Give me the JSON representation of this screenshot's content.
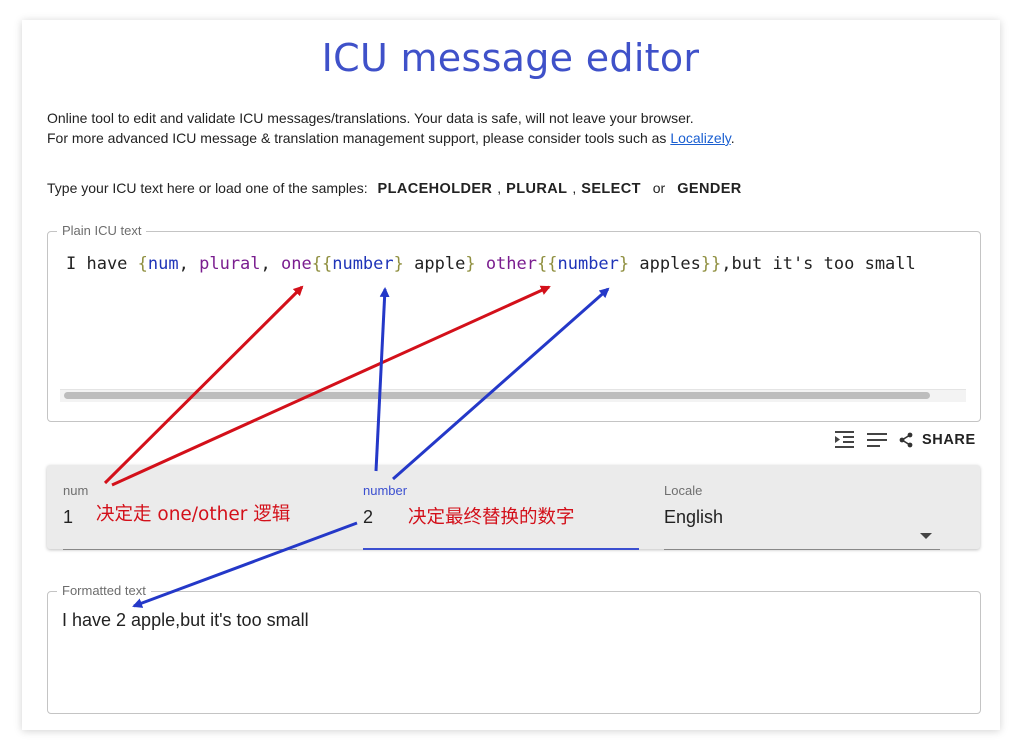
{
  "page": {
    "title": "ICU message editor",
    "description_line1": "Online tool to edit and validate ICU messages/translations. Your data is safe, will not leave your browser.",
    "description_line2_prefix": "For more advanced ICU message & translation management support, please consider tools such as ",
    "description_link": "Localizely",
    "description_line2_suffix": "."
  },
  "samples": {
    "intro": "Type your ICU text here or load one of the samples:",
    "placeholder_label": "PLACEHOLDER",
    "plural_label": "PLURAL",
    "select_label": "SELECT",
    "or_text": "or",
    "gender_label": "GENDER",
    "comma": ","
  },
  "editor": {
    "legend": "Plain ICU text",
    "tokens": {
      "t1": "I have ",
      "t2": "{",
      "t3": "num",
      "t4": ", ",
      "t5": "plural",
      "t6": ", ",
      "t7": "one",
      "t8": "{{",
      "t9": "number",
      "t10": "}",
      "t11": " apple",
      "t12": "}",
      "t13": " ",
      "t14": "other",
      "t15": "{{",
      "t16": "number",
      "t17": "}",
      "t18": " apples",
      "t19": "}}",
      "t20": ",but it's too small"
    }
  },
  "toolbar": {
    "indent_icon": "format-indent-icon",
    "wrap_icon": "wrap-text-icon",
    "share_icon": "share-icon",
    "share_label": "SHARE"
  },
  "params": {
    "num": {
      "label": "num",
      "value": "1"
    },
    "number": {
      "label": "number",
      "value": "2"
    },
    "locale": {
      "label": "Locale",
      "value": "English"
    }
  },
  "annotations": {
    "num_note": "决定走 one/other 逻辑",
    "number_note": "决定最终替换的数字",
    "color_red": "#d3101a",
    "color_blue": "#2438c8"
  },
  "output": {
    "legend": "Formatted text",
    "text": "I have 2 apple,but it's too small"
  },
  "colors": {
    "title": "#3f51c9",
    "active_field": "#3b4fd0",
    "link": "#1a5fd1"
  }
}
